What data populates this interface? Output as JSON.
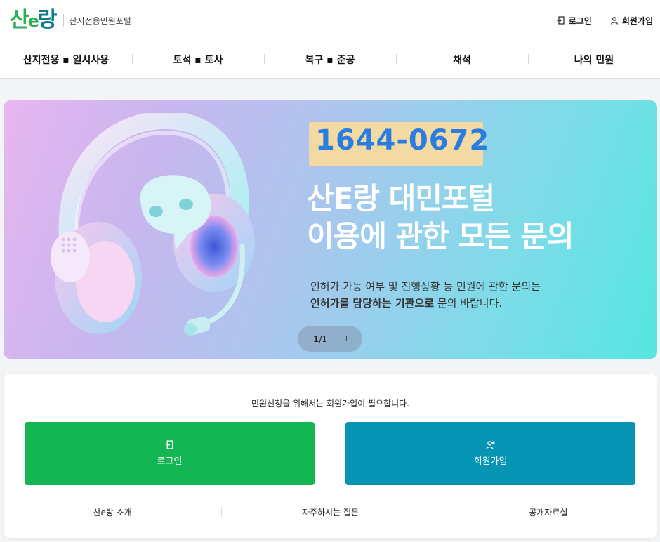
{
  "header": {
    "logo_text_1": "산",
    "logo_text_2": "e",
    "logo_text_3": "랑",
    "logo_subtitle": "산지전용민원포털",
    "login_label": "로그인",
    "signup_label": "회원가입"
  },
  "nav": {
    "items": [
      {
        "label": "산지전용 ▪ 일시사용"
      },
      {
        "label": "토석 ▪ 토사"
      },
      {
        "label": "복구 ▪ 준공"
      },
      {
        "label": "채석"
      },
      {
        "label": "나의 민원"
      }
    ]
  },
  "banner": {
    "phone": "1644-0672",
    "headline_line1": "산E랑 대민포털",
    "headline_line2": "이용에 관한 모든 문의",
    "desc_line1": "인허가 가능 여부 및 진행상황 등 민원에 관한 문의는",
    "desc_line2_bold": "인허가를 담당하는 기관으로",
    "desc_line2_rest": " 문의 바랍니다.",
    "pager_current": "1",
    "pager_sep": "/",
    "pager_total": "1",
    "pause_symbol": "II"
  },
  "panel": {
    "notice": "민원신청을 위해서는 회원가입이 필요합니다.",
    "login_button": "로그인",
    "signup_button": "회원가입",
    "links": [
      {
        "label": "산e랑 소개"
      },
      {
        "label": "자주하시는 질문"
      },
      {
        "label": "공개자료실"
      }
    ]
  },
  "colors": {
    "brand_green": "#14b553",
    "brand_teal": "#0694b3",
    "phone_blue": "#2a7de0"
  }
}
